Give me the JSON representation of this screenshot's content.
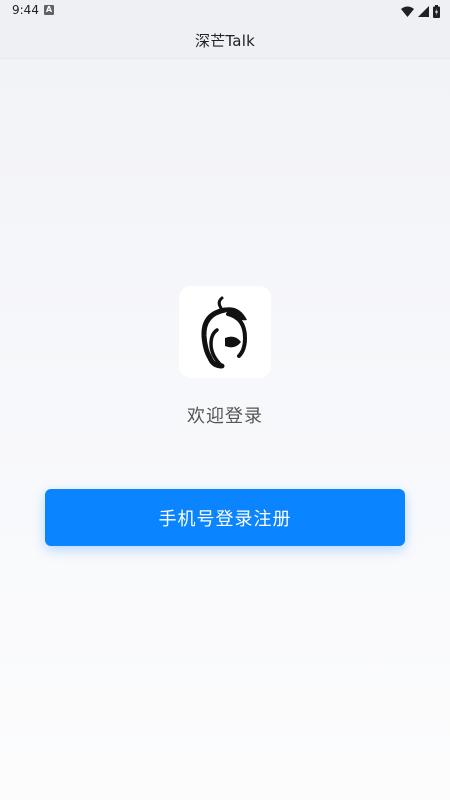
{
  "status_bar": {
    "time": "9:44",
    "notification_icon": "A",
    "icons": [
      "wifi-icon",
      "signal-icon",
      "battery-icon"
    ]
  },
  "app_bar": {
    "title": "深芒Talk"
  },
  "main": {
    "logo_icon": "mango-logo-icon",
    "welcome": "欢迎登录",
    "login_button_label": "手机号登录注册"
  },
  "colors": {
    "accent": "#0a84ff",
    "background": "#f5f6f9",
    "welcome_text": "#555555"
  }
}
